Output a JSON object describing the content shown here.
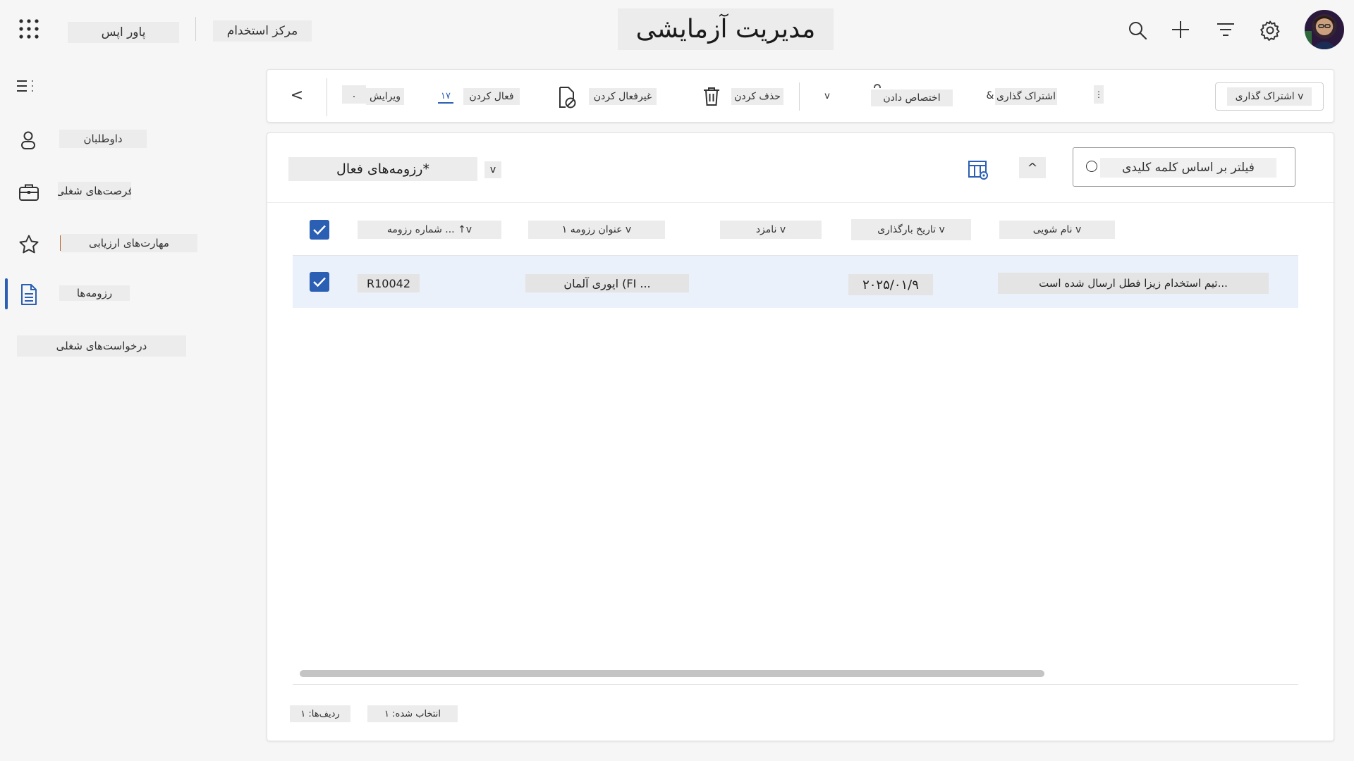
{
  "header": {
    "title": "مدیریت آزمایشی",
    "left_button_1": "پاور اپس",
    "left_button_2": "مرکز استخدام",
    "icons": [
      "app-launcher-icon",
      "search-icon",
      "plus-icon",
      "filter-icon",
      "gear-icon",
      "avatar"
    ]
  },
  "sidebar": {
    "items": [
      {
        "label": "داوطلبان",
        "icon": "person-icon"
      },
      {
        "label": "فرصت‌های شغلی",
        "icon": "briefcase-icon"
      },
      {
        "label": "مهارت‌های ارزیابی",
        "icon": "star-icon"
      },
      {
        "label": "رزومه‌ها",
        "icon": "document-icon"
      },
      {
        "label": "درخواست‌های شغلی",
        "icon": ""
      }
    ]
  },
  "toolbar": {
    "back_label": "<",
    "dot_label": ".",
    "edit_label": "ویرایش",
    "badge_label": "۱۷",
    "activate_label": "فعال کردن",
    "deactivate_label": "غیرفعال کردن",
    "delete_label": "حذف کردن",
    "chevron_label": "v",
    "share_label": "اشتراک گذاری",
    "attach_label": "اختصاص دادن",
    "amp_label": "&",
    "kebab_label": "⋮",
    "dropdown_label": "اشتراک گذاری v"
  },
  "grid": {
    "view_title": "رزومه‌های فعال*",
    "view_chevron": "v",
    "sort_label": "^",
    "search_placeholder": "فیلتر بر اساس کلمه کلیدی",
    "columns": [
      {
        "label": "عنوان رزومه ۱ v"
      },
      {
        "label": "شماره رزومه ... ↑v"
      },
      {
        "label": "نامزد v"
      },
      {
        "label": "تاریخ بارگذاری v"
      },
      {
        "label": "نام شویی v"
      }
    ],
    "rows": [
      {
        "resume_number": "R10042",
        "title": "ایوری آلمان (FI ...",
        "date": "۲۰۲۵/۰۱/۹",
        "name": "تیم استخدام زیزا فطل ارسال شده است..."
      }
    ],
    "footer_rows": "ردیف‌ها: ۱",
    "footer_selected": "انتخاب شده: ۱"
  },
  "colors": {
    "accent": "#2b5fb3",
    "selected_row": "#eaf1fa",
    "background": "#f6f6f6"
  }
}
